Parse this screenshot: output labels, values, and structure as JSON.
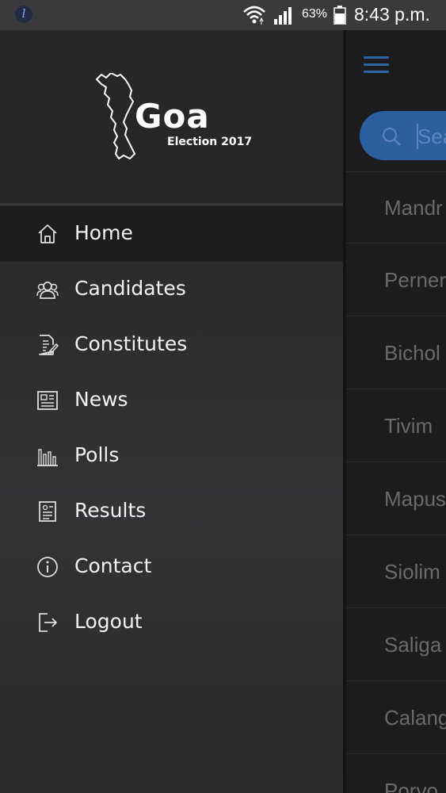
{
  "status_bar": {
    "app_glyph": "l",
    "battery_percent": "63%",
    "time": "8:43 p.m.",
    "icons": [
      "app-notification-icon",
      "wifi-icon",
      "cell-signal-icon",
      "battery-icon"
    ]
  },
  "drawer": {
    "logo": {
      "title": "Goa",
      "subtitle": "Election 2017"
    },
    "items": [
      {
        "label": "Home",
        "icon": "home-icon",
        "active": true
      },
      {
        "label": "Candidates",
        "icon": "candidates-icon",
        "active": false
      },
      {
        "label": "Constitutes",
        "icon": "document-edit-icon",
        "active": false
      },
      {
        "label": "News",
        "icon": "newspaper-icon",
        "active": false
      },
      {
        "label": "Polls",
        "icon": "bar-chart-icon",
        "active": false
      },
      {
        "label": "Results",
        "icon": "results-icon",
        "active": false
      },
      {
        "label": "Contact",
        "icon": "info-icon",
        "active": false
      },
      {
        "label": "Logout",
        "icon": "logout-icon",
        "active": false
      }
    ]
  },
  "background_screen": {
    "search_placeholder": "Sea",
    "constituencies": [
      "Mandr",
      "Perner",
      "Bichol",
      "Tivim",
      "Mapus",
      "Siolim",
      "Saliga",
      "Calang",
      "Porvo"
    ]
  },
  "colors": {
    "accent": "#2b5fa0",
    "drawer_bg": "#2e2e30",
    "active_item_bg": "#1c1c1e"
  }
}
